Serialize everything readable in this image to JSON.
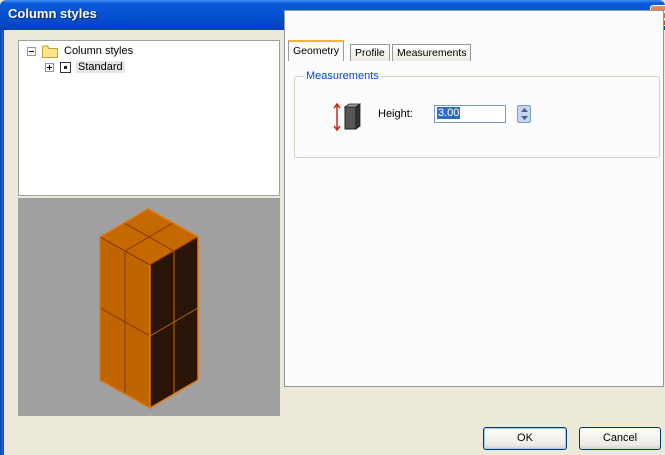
{
  "window": {
    "title": "Column styles"
  },
  "tree": {
    "root_label": "Column styles",
    "child_label": "Standard"
  },
  "tabs": [
    {
      "label": "Geometry",
      "active": true
    },
    {
      "label": "Profile",
      "active": false
    },
    {
      "label": "Measurements",
      "active": false
    }
  ],
  "measurements": {
    "group_label": "Measurements",
    "height_label": "Height:",
    "height_value": "3.00"
  },
  "buttons": {
    "ok": "OK",
    "cancel": "Cancel"
  },
  "colors": {
    "title_blue": "#0452d0",
    "column_fill": "#c86a00",
    "column_dark": "#2a1408",
    "preview_bg": "#a0a0a0",
    "accent_tab": "#f8b234"
  }
}
